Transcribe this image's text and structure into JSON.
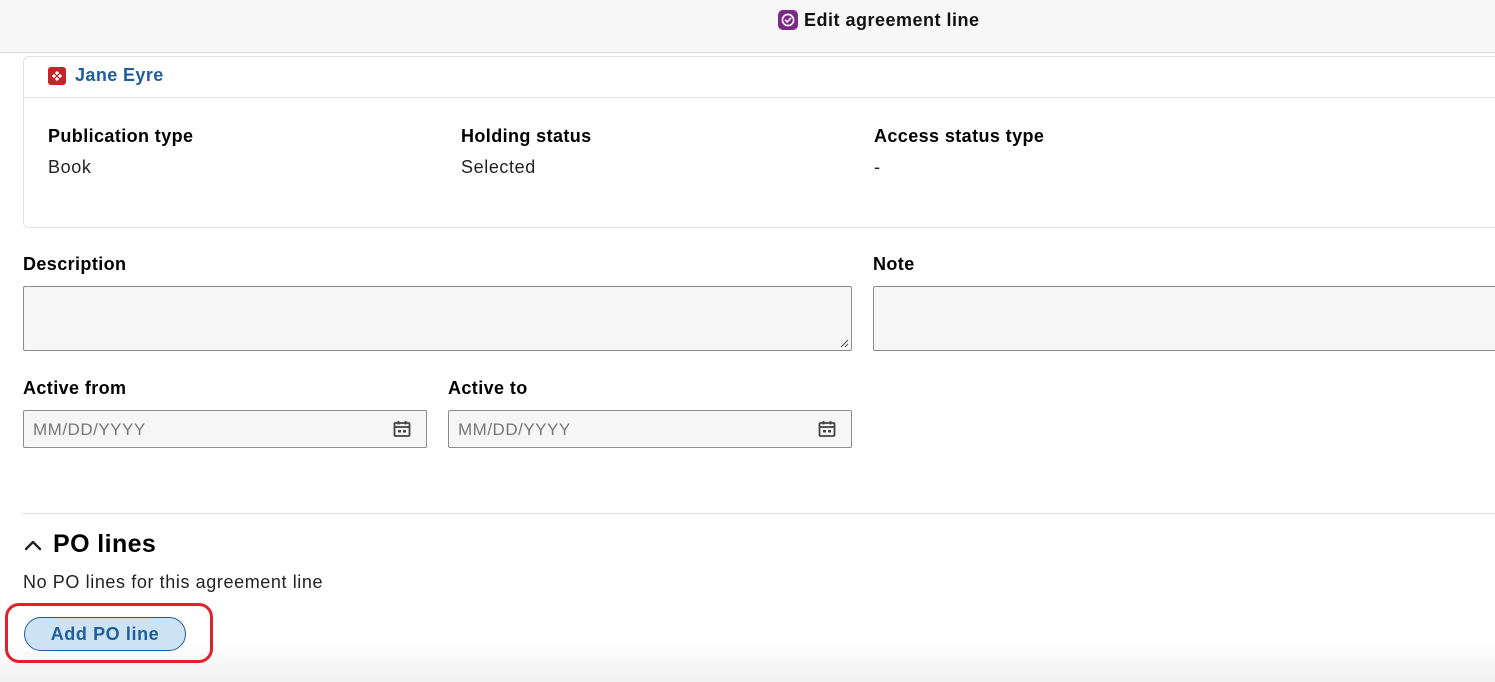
{
  "header": {
    "title": "Edit agreement line",
    "icon": "check-badge-icon",
    "accent": "#7b2a87"
  },
  "resource": {
    "title": "Jane Eyre",
    "icon": "resource-icon",
    "fields": [
      {
        "label": "Publication type",
        "value": "Book"
      },
      {
        "label": "Holding status",
        "value": "Selected"
      },
      {
        "label": "Access status type",
        "value": "-"
      }
    ]
  },
  "form": {
    "description_label": "Description",
    "note_label": "Note",
    "active_from_label": "Active from",
    "active_to_label": "Active to",
    "date_placeholder": "MM/DD/YYYY"
  },
  "po_lines": {
    "title": "PO lines",
    "empty_text": "No PO lines for this agreement line",
    "add_button": "Add PO line"
  },
  "colors": {
    "link": "#1f5e9c",
    "highlight": "#e3202a"
  }
}
